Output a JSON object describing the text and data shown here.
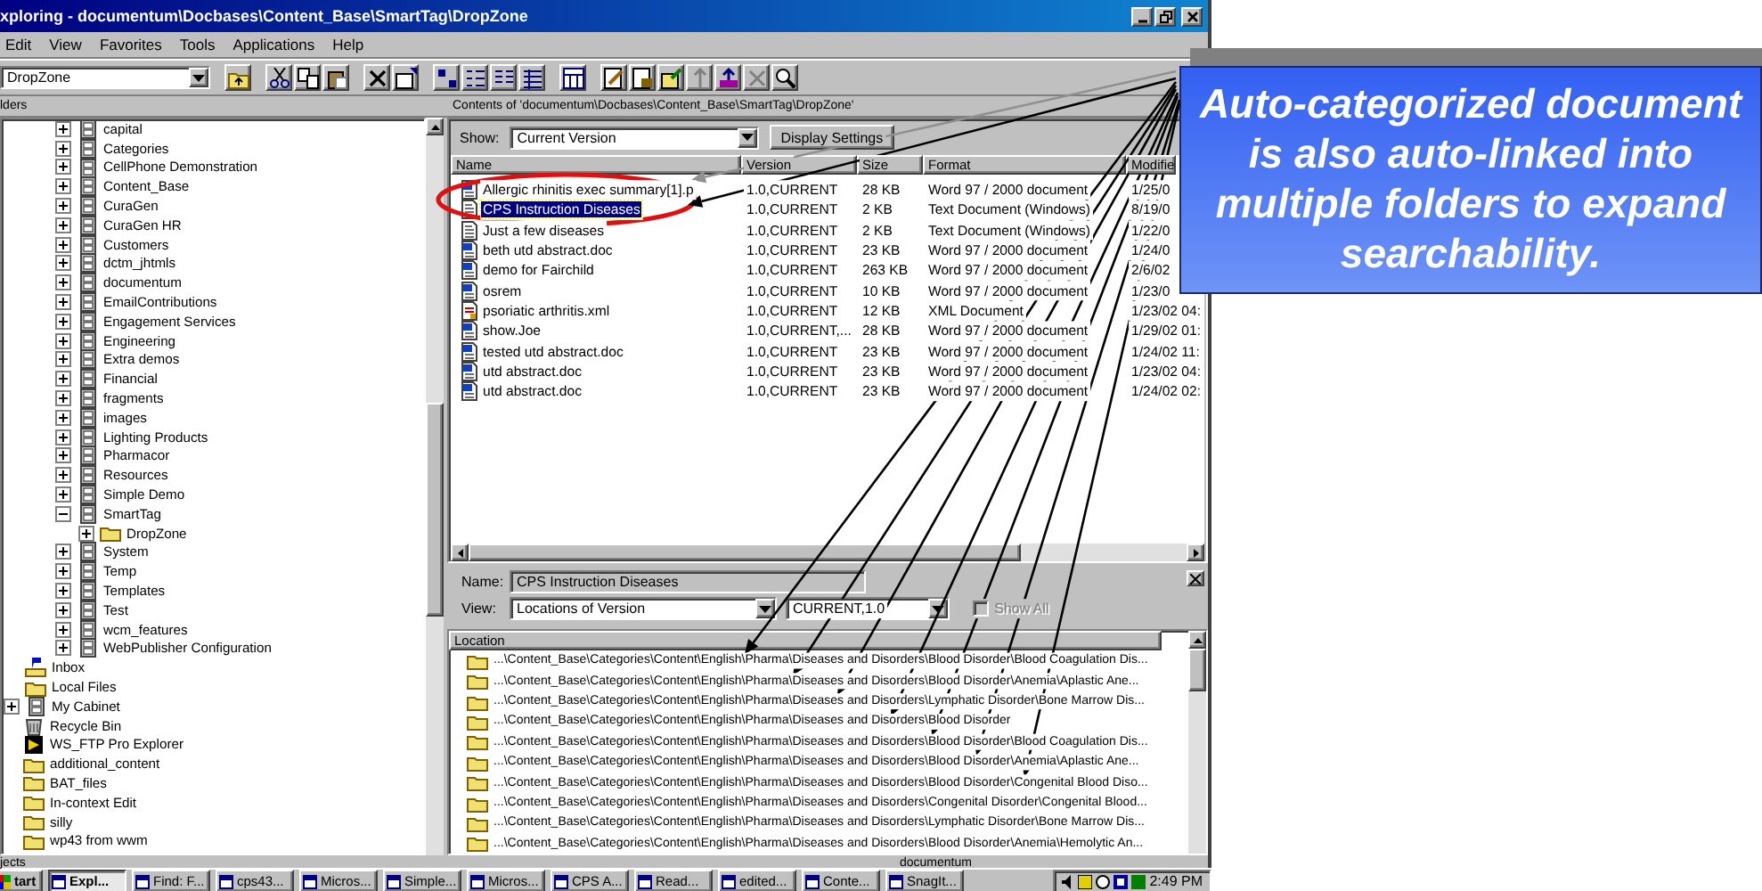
{
  "window": {
    "title": "xploring - documentum\\Docbases\\Content_Base\\SmartTag\\DropZone"
  },
  "menu": [
    "Edit",
    "View",
    "Favorites",
    "Tools",
    "Applications",
    "Help"
  ],
  "address": {
    "value": "DropZone"
  },
  "folders_pane": {
    "header": "lders",
    "docbase_folders": [
      {
        "label": "capital",
        "kind": "cabinet",
        "expanded": false
      },
      {
        "label": "Categories",
        "kind": "cabinet",
        "expanded": false
      },
      {
        "label": "CellPhone Demonstration",
        "kind": "cabinet",
        "expanded": false
      },
      {
        "label": "Content_Base",
        "kind": "cabinet",
        "expanded": false
      },
      {
        "label": "CuraGen",
        "kind": "cabinet",
        "expanded": false
      },
      {
        "label": "CuraGen HR",
        "kind": "cabinet",
        "expanded": false
      },
      {
        "label": "Customers",
        "kind": "cabinet",
        "expanded": false
      },
      {
        "label": "dctm_jhtmls",
        "kind": "cabinet",
        "expanded": false
      },
      {
        "label": "documentum",
        "kind": "cabinet",
        "expanded": false
      },
      {
        "label": "EmailContributions",
        "kind": "cabinet",
        "expanded": false
      },
      {
        "label": "Engagement Services",
        "kind": "cabinet",
        "expanded": false
      },
      {
        "label": "Engineering",
        "kind": "cabinet",
        "expanded": false
      },
      {
        "label": "Extra demos",
        "kind": "cabinet",
        "expanded": false
      },
      {
        "label": "Financial",
        "kind": "cabinet",
        "expanded": false
      },
      {
        "label": "fragments",
        "kind": "cabinet",
        "expanded": false
      },
      {
        "label": "images",
        "kind": "cabinet",
        "expanded": false
      },
      {
        "label": "Lighting Products",
        "kind": "cabinet",
        "expanded": false
      },
      {
        "label": "Pharmacor",
        "kind": "cabinet",
        "expanded": false
      },
      {
        "label": "Resources",
        "kind": "cabinet",
        "expanded": false
      },
      {
        "label": "Simple Demo",
        "kind": "cabinet",
        "expanded": false
      },
      {
        "label": "SmartTag",
        "kind": "cabinet",
        "expanded": true,
        "children": [
          {
            "label": "DropZone",
            "kind": "folder",
            "expanded": false
          }
        ]
      },
      {
        "label": "System",
        "kind": "cabinet",
        "expanded": false
      },
      {
        "label": "Temp",
        "kind": "cabinet",
        "expanded": false
      },
      {
        "label": "Templates",
        "kind": "cabinet",
        "expanded": false
      },
      {
        "label": "Test",
        "kind": "cabinet",
        "expanded": false
      },
      {
        "label": "wcm_features",
        "kind": "cabinet",
        "expanded": false
      },
      {
        "label": "WebPublisher Configuration",
        "kind": "cabinet",
        "expanded": false
      }
    ],
    "cabinet_items": [
      {
        "label": "Inbox",
        "kind": "inbox"
      },
      {
        "label": "Local Files",
        "kind": "folder"
      },
      {
        "label": "My Cabinet",
        "kind": "cabinet",
        "expanded": false
      }
    ],
    "desktop_items": [
      {
        "label": "Recycle Bin",
        "kind": "recycle"
      },
      {
        "label": "WS_FTP Pro Explorer",
        "kind": "app"
      },
      {
        "label": "additional_content",
        "kind": "folder"
      },
      {
        "label": "BAT_files",
        "kind": "folder"
      },
      {
        "label": "In-context Edit",
        "kind": "folder"
      },
      {
        "label": "silly",
        "kind": "folder"
      },
      {
        "label": "wp43 from wwm",
        "kind": "folder"
      }
    ]
  },
  "contents": {
    "header": "Contents of 'documentum\\Docbases\\Content_Base\\SmartTag\\DropZone'",
    "show_label": "Show:",
    "show_value": "Current Version",
    "display_settings": "Display Settings",
    "columns": [
      "Name",
      "Version",
      "Size",
      "Format",
      "Modifie"
    ],
    "files": [
      {
        "name": "Allergic rhinitis exec summary[1].p",
        "kind": "word",
        "version": "1.0,CURRENT",
        "size": "28 KB",
        "format": "Word 97 / 2000 document",
        "modified": "1/25/0",
        "selected": false
      },
      {
        "name": "CPS Instruction Diseases",
        "kind": "text",
        "version": "1.0,CURRENT",
        "size": "2 KB",
        "format": "Text Document (Windows)",
        "modified": "8/19/0",
        "selected": true
      },
      {
        "name": "Just a few diseases",
        "kind": "text",
        "version": "1.0,CURRENT",
        "size": "2 KB",
        "format": "Text Document (Windows)",
        "modified": "1/22/0",
        "selected": false
      },
      {
        "name": "beth utd abstract.doc",
        "kind": "word",
        "version": "1.0,CURRENT",
        "size": "23 KB",
        "format": "Word 97 / 2000 document",
        "modified": "1/24/0",
        "selected": false
      },
      {
        "name": "demo for Fairchild",
        "kind": "word",
        "version": "1.0,CURRENT",
        "size": "263 KB",
        "format": "Word 97 / 2000 document",
        "modified": "2/6/02",
        "selected": false
      },
      {
        "name": "osrem",
        "kind": "word",
        "version": "1.0,CURRENT",
        "size": "10 KB",
        "format": "Word 97 / 2000 document",
        "modified": "1/23/0",
        "selected": false
      },
      {
        "name": "psoriatic arthritis.xml",
        "kind": "xml",
        "version": "1.0,CURRENT",
        "size": "12 KB",
        "format": "XML Document",
        "modified": "1/23/02 04:",
        "selected": false
      },
      {
        "name": "show.Joe",
        "kind": "word",
        "version": "1.0,CURRENT,...",
        "size": "28 KB",
        "format": "Word 97 / 2000 document",
        "modified": "1/29/02 01:",
        "selected": false
      },
      {
        "name": "tested utd abstract.doc",
        "kind": "word",
        "version": "1.0,CURRENT",
        "size": "23 KB",
        "format": "Word 97 / 2000 document",
        "modified": "1/24/02 11:",
        "selected": false
      },
      {
        "name": "utd abstract.doc",
        "kind": "word",
        "version": "1.0,CURRENT",
        "size": "23 KB",
        "format": "Word 97 / 2000 document",
        "modified": "1/23/02 04:",
        "selected": false
      },
      {
        "name": "utd abstract.doc",
        "kind": "word",
        "version": "1.0,CURRENT",
        "size": "23 KB",
        "format": "Word 97 / 2000 document",
        "modified": "1/24/02 02:",
        "selected": false
      }
    ]
  },
  "details": {
    "name_label": "Name:",
    "name_value": "CPS Instruction Diseases",
    "view_label": "View:",
    "view_value": "Locations of Version",
    "version_value": "CURRENT,1.0",
    "show_all": {
      "label": "Show All",
      "checked": false,
      "disabled": true
    },
    "location_column": "Location",
    "locations": [
      "...\\Content_Base\\Categories\\Content\\English\\Pharma\\Diseases and Disorders\\Blood Disorder\\Blood Coagulation Dis...",
      "...\\Content_Base\\Categories\\Content\\English\\Pharma\\Diseases and Disorders\\Blood Disorder\\Anemia\\Aplastic Ane...",
      "...\\Content_Base\\Categories\\Content\\English\\Pharma\\Diseases and Disorders\\Lymphatic Disorder\\Bone Marrow Dis...",
      "...\\Content_Base\\Categories\\Content\\English\\Pharma\\Diseases and Disorders\\Blood Disorder",
      "...\\Content_Base\\Categories\\Content\\English\\Pharma\\Diseases and Disorders\\Blood Disorder\\Blood Coagulation Dis...",
      "...\\Content_Base\\Categories\\Content\\English\\Pharma\\Diseases and Disorders\\Blood Disorder\\Anemia\\Aplastic Ane...",
      "...\\Content_Base\\Categories\\Content\\English\\Pharma\\Diseases and Disorders\\Blood Disorder\\Congenital Blood Diso...",
      "...\\Content_Base\\Categories\\Content\\English\\Pharma\\Diseases and Disorders\\Congenital Disorder\\Congenital Blood...",
      "...\\Content_Base\\Categories\\Content\\English\\Pharma\\Diseases and Disorders\\Lymphatic Disorder\\Bone Marrow Dis...",
      "...\\Content_Base\\Categories\\Content\\English\\Pharma\\Diseases and Disorders\\Blood Disorder\\Anemia\\Hemolytic An..."
    ]
  },
  "status_bar": [
    "jects",
    "documentum"
  ],
  "taskbar": {
    "start": "tart",
    "buttons": [
      {
        "label": "Expl...",
        "selected": true
      },
      {
        "label": "Find: F...",
        "selected": false
      },
      {
        "label": "cps43...",
        "selected": false
      },
      {
        "label": "Micros...",
        "selected": false
      },
      {
        "label": "Simple...",
        "selected": false
      },
      {
        "label": "Micros...",
        "selected": false
      },
      {
        "label": "CPS A...",
        "selected": false
      },
      {
        "label": "Read...",
        "selected": false
      },
      {
        "label": "edited...",
        "selected": false
      },
      {
        "label": "Conte...",
        "selected": false
      },
      {
        "label": "SnagIt...",
        "selected": false
      }
    ],
    "clock": "2:49 PM"
  },
  "callout": {
    "text": "Auto-categorized document is also auto-linked into multiple folders to expand searchability."
  }
}
